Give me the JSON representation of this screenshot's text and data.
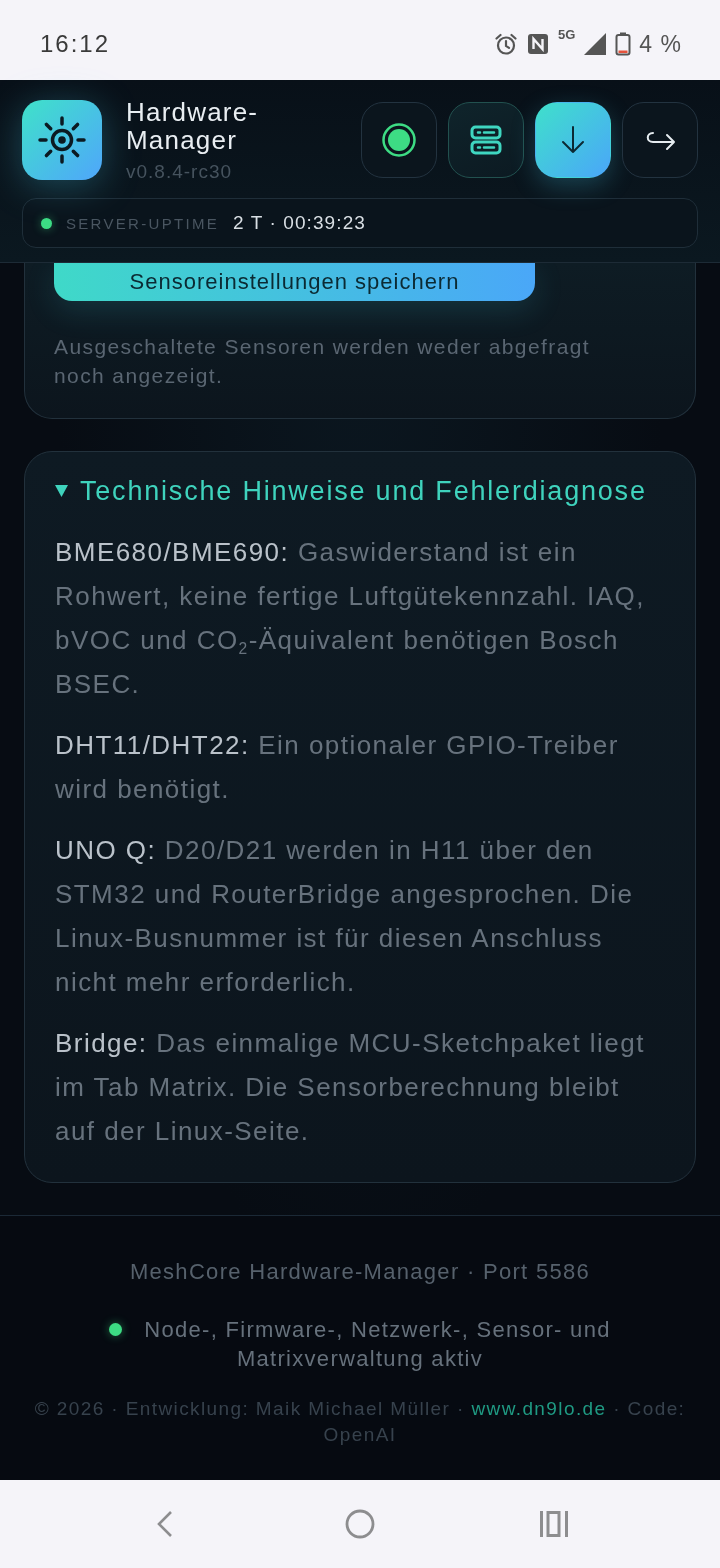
{
  "status_bar": {
    "time": "16:12",
    "network": "5G",
    "battery": "4 %"
  },
  "header": {
    "title": "Hardware-Manager",
    "version": "v0.8.4-rc30",
    "actions": [
      {
        "kind": "status",
        "active": false,
        "primary": false
      },
      {
        "kind": "servers",
        "active": true,
        "primary": false
      },
      {
        "kind": "download",
        "active": false,
        "primary": true
      },
      {
        "kind": "exit",
        "active": false,
        "primary": false
      }
    ]
  },
  "uptime": {
    "label": "SERVER-UPTIME",
    "value": "2 T · 00:39:23",
    "online": true
  },
  "sensor_card": {
    "save_button": "Sensoreinstellungen speichern",
    "note": "Ausgeschaltete Sensoren werden weder abgefragt noch angezeigt."
  },
  "notes": {
    "title": "Technische Hinweise und Fehlerdiagnose",
    "expanded": true,
    "items": [
      {
        "term": "BME680/BME690:",
        "text": "Gaswiderstand ist ein Rohwert, keine fertige Luftgütekennzahl. IAQ, bVOC und CO$_{2}$-Äquivalent benötigen Bosch BSEC."
      },
      {
        "term": "DHT11/DHT22:",
        "text": "Ein optionaler GPIO-Treiber wird benötigt."
      },
      {
        "term": "UNO Q:",
        "text": "D20/D21 werden in H11 über den STM32 und RouterBridge angesprochen. Die Linux-Busnummer ist für diesen Anschluss nicht mehr erforderlich."
      },
      {
        "term": "Bridge:",
        "text": "Das einmalige MCU-Sketchpaket liegt im Tab Matrix. Die Sensorberechnung bleibt auf der Linux-Seite."
      }
    ]
  },
  "footer": {
    "title": "MeshCore Hardware-Manager · Port 5586",
    "status": {
      "text": "Node-, Firmware-, Netzwerk-, Sensor- und Matrixverwaltung aktiv",
      "active": true
    },
    "credits": {
      "text_before": "© 2026 · Entwicklung: Maik Michael Müller · ",
      "link": "www.dn9lo.de",
      "text_after": " · Code: OpenAI"
    }
  },
  "nav_bar": {
    "buttons": [
      {
        "kind": "back"
      },
      {
        "kind": "home"
      },
      {
        "kind": "recents"
      }
    ]
  }
}
